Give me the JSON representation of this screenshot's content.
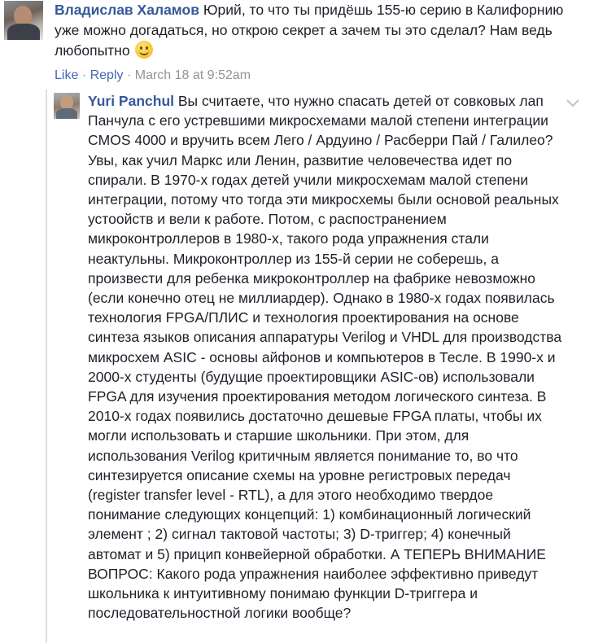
{
  "comment1": {
    "author": "Владислав Халамов",
    "text": "Юрий, то что ты придёшь 155-ю серию в Калифорнию уже можно догадаться, но открою секрет а зачем ты это сделал? Нам ведь любопытно",
    "emoji": "smiley-emoji",
    "actions": {
      "like": "Like",
      "separator": "·",
      "reply": "Reply",
      "timestamp": "March 18 at 9:52am"
    }
  },
  "comment2": {
    "author": "Yuri Panchul",
    "text": "Вы считаете, что нужно спасать детей от совковых лап Панчула с его устревшими микросхемами малой степени интеграции CMOS 4000 и вручить всем Лего / Ардуино / Расберри Пай / Галилео? Увы, как учил Маркс или Ленин, развитие человечества идет по спирали. В 1970-х годах детей учили микросхемам малой степени интеграции, потому что тогда эти микросхемы были основой реальных устоойств и вели к работе. Потом, с распостранением микроконтроллеров в 1980-х, такого рода упражнения стали неактульны. Микроконтроллер из 155-й серии не соберешь, а произвести для ребенка микроконтроллер на фабрике невозможно (если конечно отец не миллиардер). Однако в 1980-х годах появилась технология FPGA/ПЛИС и технология проектирования на основе синтеза языков описания аппаратуры Verilog и VHDL для производства микросхем ASIC - основы айфонов и компьютеров в Тесле. В 1990-х и 2000-х студенты (будущие проектировщики ASIC-ов) использовали FPGA для изучения проектирования методом логического синтеза. В 2010-х годах появились достаточно дешевые FPGA платы, чтобы их могли использовать и старшие школьники. При этом, для использования Verilog критичным является понимание то, во что синтезируется описание схемы на уровне регистровых передач (register transfer level - RTL), а для этого необходимо твердое понимание следующих концепций: 1) комбинационный логический элемент ; 2) сигнал тактовой частоты; 3) D-триггер; 4) конечный автомат и 5) прицип конвейерной обработки. А ТЕПЕРЬ ВНИМАНИЕ ВОПРОС: Какого рода упражнения наиболее эффективно приведут школьника к интуитивному понимаю функции D-триггера и последовательностной логики вообще?",
    "menu_icon": "chevron-down-icon"
  },
  "colors": {
    "author": "#365899",
    "link": "#4267b2",
    "meta": "#90949c",
    "text": "#1d2129"
  }
}
